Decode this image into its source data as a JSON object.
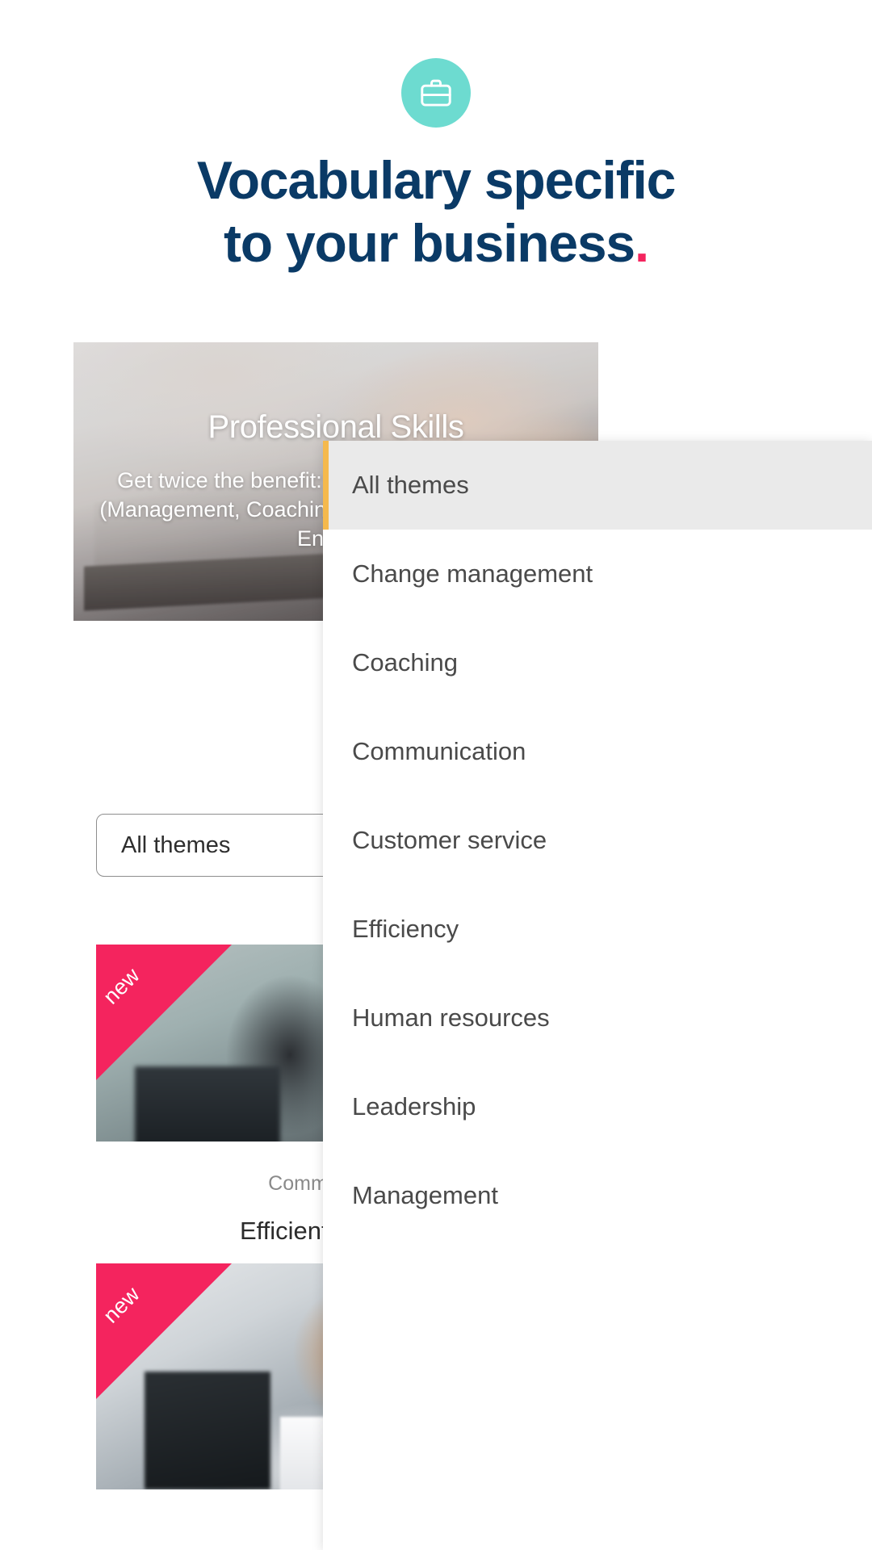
{
  "header": {
    "icon": "briefcase-icon",
    "icon_bg_color": "#6ddbd0",
    "title_line1": "Vocabulary specific",
    "title_line2": "to your business",
    "title_period": ".",
    "title_color": "#0a3a66",
    "period_color": "#f4245e"
  },
  "hero_card": {
    "title": "Professional Skills",
    "description": "Get twice the benefit: train a professional skill (Management, Coaching…) while improving your English!"
  },
  "filter": {
    "selected_value": "All themes",
    "placeholder": "All themes"
  },
  "dropdown": {
    "open": true,
    "selected": "All themes",
    "highlight_bg": "#eaeaea",
    "accent_color": "#f5b94d",
    "items": [
      {
        "label": "All themes",
        "selected": true
      },
      {
        "label": "Change management",
        "selected": false
      },
      {
        "label": "Coaching",
        "selected": false
      },
      {
        "label": "Communication",
        "selected": false
      },
      {
        "label": "Customer service",
        "selected": false
      },
      {
        "label": "Efficiency",
        "selected": false
      },
      {
        "label": "Human resources",
        "selected": false
      },
      {
        "label": "Leadership",
        "selected": false
      },
      {
        "label": "Management",
        "selected": false
      }
    ]
  },
  "courses": [
    {
      "badge": "new",
      "badge_color": "#f4245e",
      "category": "Communication",
      "name": "Efficient meetings"
    },
    {
      "badge": "new",
      "badge_color": "#f4245e",
      "category": "",
      "name": ""
    }
  ]
}
